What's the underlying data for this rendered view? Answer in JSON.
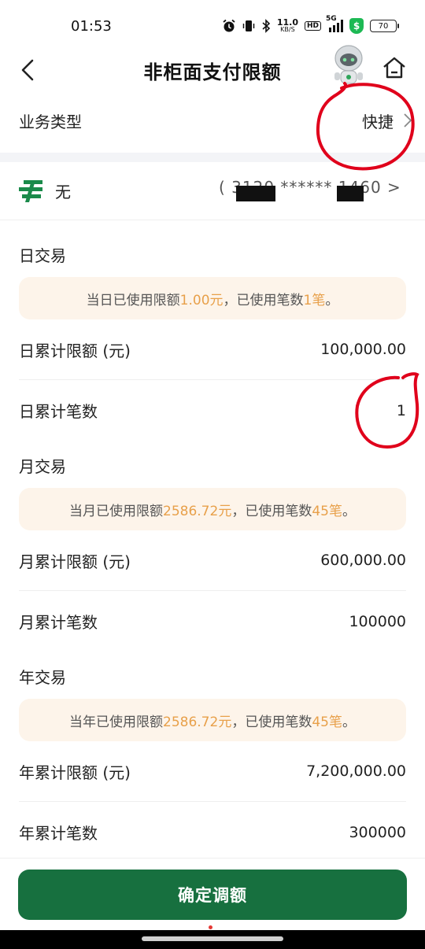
{
  "status_bar": {
    "time": "01:53",
    "network_speed_value": "11.0",
    "network_speed_unit": "KB/S",
    "hd_label": "HD",
    "signal_label": "5G",
    "battery": "70"
  },
  "nav": {
    "title": "非柜面支付限额"
  },
  "business_type": {
    "label": "业务类型",
    "value": "快捷"
  },
  "account": {
    "name": "无",
    "number": "( 3120 ****** 1460 >"
  },
  "daily": {
    "title": "日交易",
    "notice_prefix": "当日已使用限额",
    "notice_amount": "1.00元",
    "notice_middle": "，已使用笔数",
    "notice_count": "1笔",
    "notice_suffix": "。",
    "limit_label": "日累计限额 (元)",
    "limit_value": "100,000.00",
    "count_label": "日累计笔数",
    "count_value": "1"
  },
  "monthly": {
    "title": "月交易",
    "notice_prefix": "当月已使用限额",
    "notice_amount": "2586.72元",
    "notice_middle": "，已使用笔数",
    "notice_count": "45笔",
    "notice_suffix": "。",
    "limit_label": "月累计限额 (元)",
    "limit_value": "600,000.00",
    "count_label": "月累计笔数",
    "count_value": "100000"
  },
  "yearly": {
    "title": "年交易",
    "notice_prefix": "当年已使用限额",
    "notice_amount": "2586.72元",
    "notice_middle": "，已使用笔数",
    "notice_count": "45笔",
    "notice_suffix": "。",
    "limit_label": "年累计限额 (元)",
    "limit_value": "7,200,000.00",
    "count_label": "年累计笔数",
    "count_value": "300000"
  },
  "confirm_button": "确定调额",
  "colors": {
    "primary_green": "#17703f",
    "highlight_orange": "#e8a04a",
    "notice_bg": "#fdf4ea",
    "annotation_red": "#e0001b"
  },
  "icons": [
    "back-arrow-icon",
    "robot-assistant-icon",
    "home-icon",
    "chevron-right-icon",
    "postal-bank-logo-icon",
    "alarm-icon",
    "vibrate-icon",
    "bluetooth-icon",
    "shield-icon",
    "battery-icon"
  ]
}
